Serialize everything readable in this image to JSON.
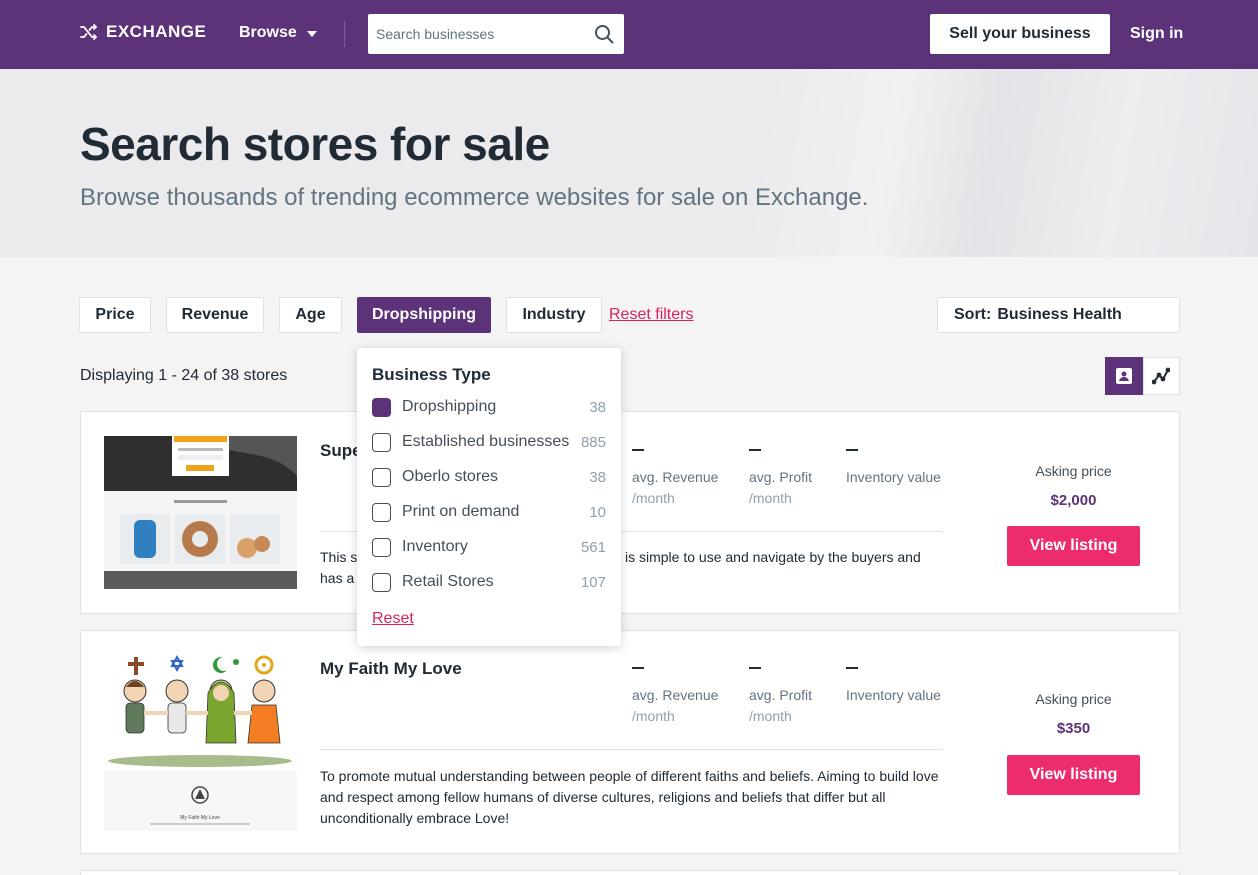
{
  "header": {
    "logo_text": "EXCHANGE",
    "browse_label": "Browse",
    "search_placeholder": "Search businesses",
    "sell_label": "Sell your business",
    "signin_label": "Sign in"
  },
  "hero": {
    "title": "Search stores for sale",
    "subtitle": "Browse thousands of trending ecommerce websites for sale on Exchange."
  },
  "filters": {
    "price": "Price",
    "revenue": "Revenue",
    "age": "Age",
    "dropshipping": "Dropshipping",
    "industry": "Industry",
    "reset": "Reset filters",
    "sort_label": "Sort:",
    "sort_value": "Business Health"
  },
  "results": {
    "displaying": "Displaying 1 - 24 of 38 stores"
  },
  "dropdown": {
    "heading": "Business Type",
    "options": [
      {
        "label": "Dropshipping",
        "count": "38",
        "checked": true
      },
      {
        "label": "Established businesses",
        "count": "885",
        "checked": false
      },
      {
        "label": "Oberlo stores",
        "count": "38",
        "checked": false
      },
      {
        "label": "Print on demand",
        "count": "10",
        "checked": false
      },
      {
        "label": "Inventory",
        "count": "561",
        "checked": false
      },
      {
        "label": "Retail Stores",
        "count": "107",
        "checked": false
      }
    ],
    "reset": "Reset"
  },
  "listings": [
    {
      "title": "Supe",
      "revenue_label": "avg. Revenue",
      "revenue_sub": "/month",
      "profit_label": "avg. Profit",
      "profit_sub": "/month",
      "inventory_label": "Inventory value",
      "desc_left_1": "This s",
      "desc_right_1": "is simple to use and navigate by the buyers and",
      "desc_left_2": "has a",
      "asking_label": "Asking price",
      "price": "$2,000",
      "cta": "View listing"
    },
    {
      "title": "My Faith My Love",
      "revenue_label": "avg. Revenue",
      "revenue_sub": "/month",
      "profit_label": "avg. Profit",
      "profit_sub": "/month",
      "inventory_label": "Inventory value",
      "desc": "To promote mutual understanding between people of different faiths and beliefs. Aiming to build love and respect among fellow humans of diverse cultures, religions and beliefs that differ but all unconditionally embrace Love!",
      "thumb_caption": "My Faith My Love",
      "asking_label": "Asking price",
      "price": "$350",
      "cta": "View listing"
    }
  ],
  "colors": {
    "brand": "#5c3379",
    "accent": "#ec2c6d",
    "link": "#d8225d"
  }
}
